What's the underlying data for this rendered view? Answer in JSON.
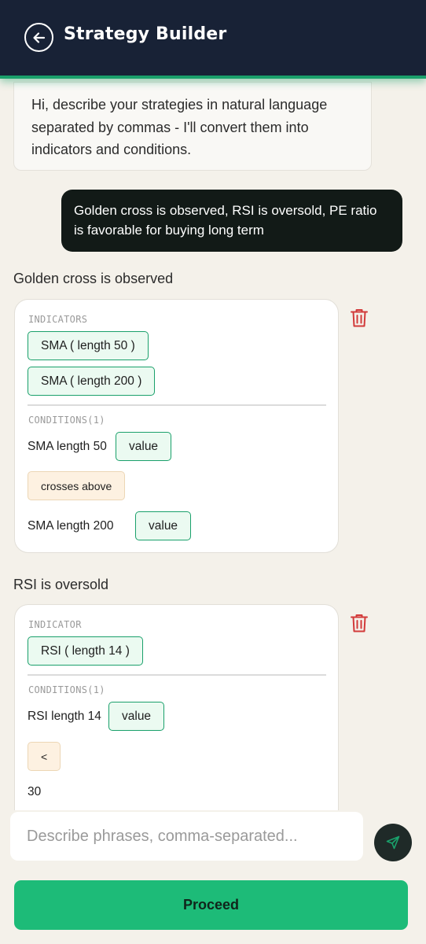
{
  "header": {
    "title": "Strategy Builder",
    "back_icon": "arrow-left-circle-icon"
  },
  "colors": {
    "header_bg": "#182236",
    "accent": "#1aa06b",
    "proceed": "#1dbb78",
    "delete": "#d23a3a"
  },
  "chat": {
    "bot_message": "Hi, describe your strategies in natural language separated by commas - I'll convert them into indicators and conditions.",
    "user_message": "Golden cross is observed, RSI is oversold, PE ratio is favorable for buying long term"
  },
  "strategies": [
    {
      "title": "Golden cross is observed",
      "indicators_label": "INDICATORS",
      "indicators": [
        "SMA ( length 50 )",
        "SMA ( length 200 )"
      ],
      "conditions_label": "CONDITIONS(1)",
      "condition": {
        "left": "SMA length 50",
        "left_value": "value",
        "operator": "crosses above",
        "right": "SMA length 200",
        "right_value": "value"
      }
    },
    {
      "title": "RSI is oversold",
      "indicators_label": "INDICATOR",
      "indicators": [
        "RSI ( length 14 )"
      ],
      "conditions_label": "CONDITIONS(1)",
      "condition": {
        "left": "RSI length 14",
        "left_value": "value",
        "operator": "<",
        "right": "30"
      }
    }
  ],
  "input": {
    "placeholder": "Describe phrases, comma-separated..."
  },
  "actions": {
    "proceed_label": "Proceed",
    "send_icon": "send-icon",
    "delete_icon": "trash-icon"
  }
}
